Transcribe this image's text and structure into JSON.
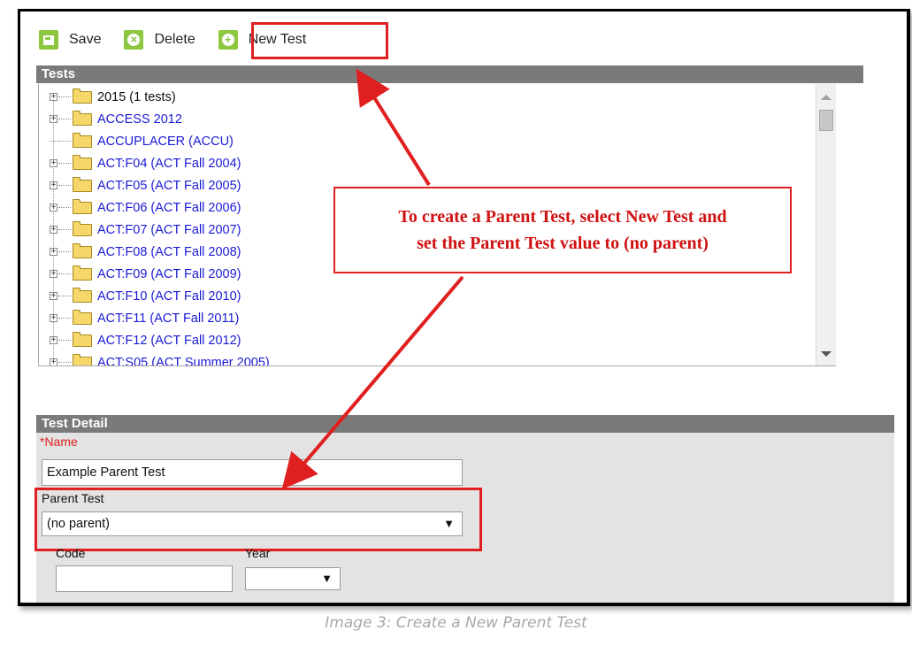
{
  "toolbar": {
    "save_label": "Save",
    "delete_label": "Delete",
    "new_test_label": "New Test"
  },
  "tests_panel": {
    "title": "Tests",
    "items": [
      {
        "label": "2015 (1 tests)",
        "expandable": true
      },
      {
        "label": "ACCESS 2012",
        "expandable": true
      },
      {
        "label": "ACCUPLACER (ACCU)",
        "expandable": false
      },
      {
        "label": "ACT:F04 (ACT Fall 2004)",
        "expandable": true
      },
      {
        "label": "ACT:F05 (ACT Fall 2005)",
        "expandable": true
      },
      {
        "label": "ACT:F06 (ACT Fall 2006)",
        "expandable": true
      },
      {
        "label": "ACT:F07 (ACT Fall 2007)",
        "expandable": true
      },
      {
        "label": "ACT:F08 (ACT Fall 2008)",
        "expandable": true
      },
      {
        "label": "ACT:F09 (ACT Fall 2009)",
        "expandable": true
      },
      {
        "label": "ACT:F10 (ACT Fall 2010)",
        "expandable": true
      },
      {
        "label": "ACT:F11 (ACT Fall 2011)",
        "expandable": true
      },
      {
        "label": "ACT:F12 (ACT Fall 2012)",
        "expandable": true
      },
      {
        "label": "ACT:S05 (ACT Summer 2005)",
        "expandable": true
      }
    ]
  },
  "callout": {
    "line1": "To create a Parent Test, select New Test and",
    "line2": "set the Parent Test value to (no parent)"
  },
  "detail": {
    "title": "Test Detail",
    "name_label": "*Name",
    "name_value": "Example Parent Test",
    "parent_label": "Parent Test",
    "parent_value": "(no parent)",
    "code_label": "Code",
    "code_value": "",
    "year_label": "Year",
    "year_value": ""
  },
  "caption": "Image 3: Create a New Parent Test",
  "colors": {
    "accent_green": "#8dc63f",
    "annotation_red": "#e02020",
    "link_blue": "#1a1ad6",
    "panel_header": "#7a7a7a"
  }
}
